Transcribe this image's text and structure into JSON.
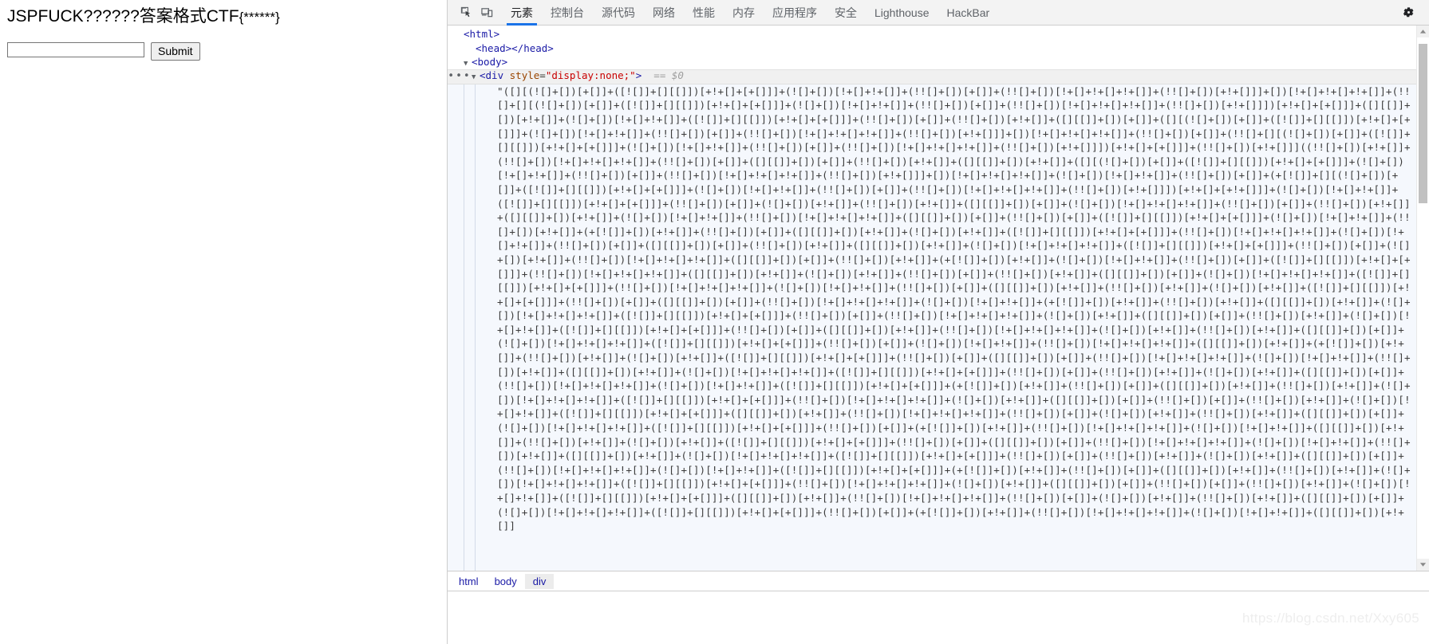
{
  "page": {
    "heading_text": "JSPFUCK??????答案格式CTF",
    "heading_suffix": "{******}",
    "input_value": "",
    "input_placeholder": "",
    "submit_label": "Submit"
  },
  "devtools": {
    "icons": {
      "inspect": "inspect-element-icon",
      "device": "device-toolbar-icon",
      "settings": "gear-icon"
    },
    "tabs": [
      {
        "label": "元素",
        "active": true
      },
      {
        "label": "控制台",
        "active": false
      },
      {
        "label": "源代码",
        "active": false
      },
      {
        "label": "网络",
        "active": false
      },
      {
        "label": "性能",
        "active": false
      },
      {
        "label": "内存",
        "active": false
      },
      {
        "label": "应用程序",
        "active": false
      },
      {
        "label": "安全",
        "active": false
      },
      {
        "label": "Lighthouse",
        "active": false
      },
      {
        "label": "HackBar",
        "active": false
      }
    ],
    "accent_color": "#1a73e8",
    "dom": {
      "line_html": "<html>",
      "line_head": "<head></head>",
      "line_body": "<body>",
      "selected": {
        "ellipsis": "•••",
        "tag_open": "<div ",
        "attr_name": "style",
        "attr_eq": "=",
        "attr_value": "\"display:none;\"",
        "tag_close": ">",
        "eq_marker": "==",
        "ref": "$0"
      },
      "text_node": "\"([][(![]+[])[+[]]+([![]]+[][[]])[+!+[]+[+[]]]+(![]+[])[!+[]+!+[]]+(!![]+[])[+[]]+(!![]+[])[!+[]+!+[]+!+[]]+(!![]+[])[+!+[]]]+[])[!+[]+!+[]+!+[]]+(!![]+[][(![]+[])[+[]]+([![]]+[][[]])[+!+[]+[+[]]]+(![]+[])[!+[]+!+[]]+(!![]+[])[+[]]+(!![]+[])[!+[]+!+[]+!+[]]+(!![]+[])[+!+[]]])[+!+[]+[+[]]]+([][[]]+[])[+!+[]]+(![]+[])[!+[]+!+[]]+([![]]+[][[]])[+!+[]+[+[]]]+(!![]+[])[+[]]+(!![]+[])[+!+[]]+([][[]]+[])[+[]]+([][(![]+[])[+[]]+([![]]+[][[]])[+!+[]+[+[]]]+(![]+[])[!+[]+!+[]]+(!![]+[])[+[]]+(!![]+[])[!+[]+!+[]+!+[]]+(!![]+[])[+!+[]]]+[])[!+[]+!+[]+!+[]]+(!![]+[])[+[]]+(!![]+[][(![]+[])[+[]]+([![]]+[][[]])[+!+[]+[+[]]]+(![]+[])[!+[]+!+[]]+(!![]+[])[+[]]+(!![]+[])[!+[]+!+[]+!+[]]+(!![]+[])[+!+[]]])[+!+[]+[+[]]]+(!![]+[])[+!+[]]]((!![]+[])[+!+[]]+(!![]+[])[!+[]+!+[]+!+[]]+(!![]+[])[+[]]+([][[]]+[])[+[]]+(!![]+[])[+!+[]]+([][[]]+[])[+!+[]]+([][(![]+[])[+[]]+([![]]+[][[]])[+!+[]+[+[]]]+(![]+[])[!+[]+!+[]]+(!![]+[])[+[]]+(!![]+[])[!+[]+!+[]+!+[]]+(!![]+[])[+!+[]]]+[])[!+[]+!+[]+!+[]]+(![]+[])[!+[]+!+[]]+(!![]+[])[+[]]+(+[![]]+[][(![]+[])[+[]]+([![]]+[][[]])[+!+[]+[+[]]]+(![]+[])[!+[]+!+[]]+(!![]+[])[+[]]+(!![]+[])[!+[]+!+[]+!+[]]+(!![]+[])[+!+[]]])[+!+[]+[+!+[]]]+(![]+[])[!+[]+!+[]]+([![]]+[][[]])[+!+[]+[+[]]]+(!![]+[])[+[]]+(![]+[])[+!+[]]+(!![]+[])[+!+[]]+([][[]]+[])[+[]]+(![]+[])[!+[]+!+[]+!+[]]+(!![]+[])[+[]]+(!![]+[])[+!+[]]+([][[]]+[])[+!+[]]+(![]+[])[!+[]+!+[]]+(!![]+[])[!+[]+!+[]+!+[]]+([][[]]+[])[+[]]+(!![]+[])[+[]]+([![]]+[][[]])[+!+[]+[+[]]]+(![]+[])[!+[]+!+[]]+(!![]+[])[+!+[]]+(+[![]]+[])[+!+[]]+(!![]+[])[+[]]+([][[]]+[])[+!+[]]+(![]+[])[+!+[]]+([![]]+[][[]])[+!+[]+[+[]]]+(!![]+[])[!+[]+!+[]+!+[]]+(![]+[])[!+[]+!+[]]+(!![]+[])[+[]]+([][[]]+[])[+[]]+(!![]+[])[+!+[]]+([][[]]+[])[+!+[]]+(![]+[])[!+[]+!+[]+!+[]]+([![]]+[][[]])[+!+[]+[+[]]]+(!![]+[])[+[]]+(![]+[])[+!+[]]+(!![]+[])[!+[]+!+[]+!+[]]+([][[]]+[])[+[]]+(!![]+[])[+!+[]]+(+[![]]+[])[+!+[]]+(![]+[])[!+[]+!+[]]+(!![]+[])[+[]]+([![]]+[][[]])[+!+[]+[+[]]]+(!![]+[])[!+[]+!+[]+!+[]]+([][[]]+[])[+!+[]]+(![]+[])[+!+[]]+(!![]+[])[+[]]+(!![]+[])[+!+[]]+([][[]]+[])[+[]]+(![]+[])[!+[]+!+[]+!+[]]+([![]]+[][[]])[+!+[]+[+[]]]+(!![]+[])[!+[]+!+[]+!+[]]+(![]+[])[!+[]+!+[]]+(!![]+[])[+[]]+([][[]]+[])[+!+[]]+(!![]+[])[+!+[]]+(![]+[])[+!+[]]+([![]]+[][[]])[+!+[]+[+[]]]+(!![]+[])[+[]]+([][[]]+[])[+[]]+(!![]+[])[!+[]+!+[]+!+[]]+(![]+[])[!+[]+!+[]]+(+[![]]+[])[+!+[]]+(!![]+[])[+!+[]]+([][[]]+[])[+!+[]]+(![]+[])[!+[]+!+[]+!+[]]+([![]]+[][[]])[+!+[]+[+[]]]+(!![]+[])[+[]]+(!![]+[])[!+[]+!+[]+!+[]]+(![]+[])[+!+[]]+([][[]]+[])[+[]]+(!![]+[])[+!+[]]+(![]+[])[!+[]+!+[]]+([![]]+[][[]])[+!+[]+[+[]]]+(!![]+[])[+[]]+([][[]]+[])[+!+[]]+(!![]+[])[!+[]+!+[]+!+[]]+(![]+[])[+!+[]]+(!![]+[])[+!+[]]+([][[]]+[])[+[]]+(![]+[])[!+[]+!+[]+!+[]]+([![]]+[][[]])[+!+[]+[+[]]]+(!![]+[])[+[]]+(![]+[])[!+[]+!+[]]+(!![]+[])[!+[]+!+[]+!+[]]+([][[]]+[])[+!+[]]+(+[![]]+[])[+!+[]]+(!![]+[])[+!+[]]+(![]+[])[+!+[]]+([![]]+[][[]])[+!+[]+[+[]]]+(!![]+[])[+[]]+([][[]]+[])[+[]]+(!![]+[])[!+[]+!+[]+!+[]]+(![]+[])[!+[]+!+[]]+(!![]+[])[+!+[]]+([][[]]+[])[+!+[]]+(![]+[])[!+[]+!+[]+!+[]]+([![]]+[][[]])[+!+[]+[+[]]]+(!![]+[])[+[]]+(!![]+[])[+!+[]]+(![]+[])[+!+[]]+([][[]]+[])[+[]]+(!![]+[])[!+[]+!+[]+!+[]]+(![]+[])[!+[]+!+[]]+([![]]+[][[]])[+!+[]+[+[]]]+(+[![]]+[])[+!+[]]+(!![]+[])[+[]]+([][[]]+[])[+!+[]]+(!![]+[])[+!+[]]+(![]+[])[!+[]+!+[]+!+[]]+([![]]+[][[]])[+!+[]+[+[]]]+(!![]+[])[!+[]+!+[]+!+[]]+(![]+[])[+!+[]]+([][[]]+[])[+[]]+(!![]+[])[+[]]+(!![]+[])[+!+[]]+(![]+[])[!+[]+!+[]]+([![]]+[][[]])[+!+[]+[+[]]]+([][[]]+[])[+!+[]]+(!![]+[])[!+[]+!+[]+!+[]]+(!![]+[])[+[]]+(![]+[])[+!+[]]+(!![]+[])[+!+[]]+([][[]]+[])[+[]]+(![]+[])[!+[]+!+[]+!+[]]+([![]]+[][[]])[+!+[]+[+[]]]+(!![]+[])[+[]]+(+[![]]+[])[+!+[]]+(!![]+[])[!+[]+!+[]+!+[]]+(![]+[])[!+[]+!+[]]+([][[]]+[])[+!+[]]+(!![]+[])[+!+[]]+(![]+[])[+!+[]]+([![]]+[][[]])[+!+[]+[+[]]]+(!![]+[])[+[]]+([][[]]+[])[+[]]+(!![]+[])[!+[]+!+[]+!+[]]+(![]+[])[!+[]+!+[]]+(!![]+[])[+!+[]]+([][[]]+[])[+!+[]]+(![]+[])[!+[]+!+[]+!+[]]+([![]]+[][[]])[+!+[]+[+[]]]+(!![]+[])[+[]]+(!![]+[])[+!+[]]+(![]+[])[+!+[]]+([][[]]+[])[+[]]+(!![]+[])[!+[]+!+[]+!+[]]+(![]+[])[!+[]+!+[]]+([![]]+[][[]])[+!+[]+[+[]]]+(+[![]]+[])[+!+[]]+(!![]+[])[+[]]+([][[]]+[])[+!+[]]+(!![]+[])[+!+[]]+(![]+[])[!+[]+!+[]+!+[]]+([![]]+[][[]])[+!+[]+[+[]]]+(!![]+[])[!+[]+!+[]+!+[]]+(![]+[])[+!+[]]+([][[]]+[])[+[]]+(!![]+[])[+[]]+(!![]+[])[+!+[]]+(![]+[])[!+[]+!+[]]+([![]]+[][[]])[+!+[]+[+[]]]+([][[]]+[])[+!+[]]+(!![]+[])[!+[]+!+[]+!+[]]+(!![]+[])[+[]]+(![]+[])[+!+[]]+(!![]+[])[+!+[]]+([][[]]+[])[+[]]+(![]+[])[!+[]+!+[]+!+[]]+([![]]+[][[]])[+!+[]+[+[]]]+(!![]+[])[+[]]+(+[![]]+[])[+!+[]]+(!![]+[])[!+[]+!+[]+!+[]]+(![]+[])[!+[]+!+[]]+([][[]]+[])[+!+[]]",
      "breadcrumbs": [
        {
          "label": "html",
          "selected": false
        },
        {
          "label": "body",
          "selected": false
        },
        {
          "label": "div",
          "selected": true
        }
      ]
    }
  },
  "watermark": {
    "text": "https://blog.csdn.net/Xxy605"
  }
}
